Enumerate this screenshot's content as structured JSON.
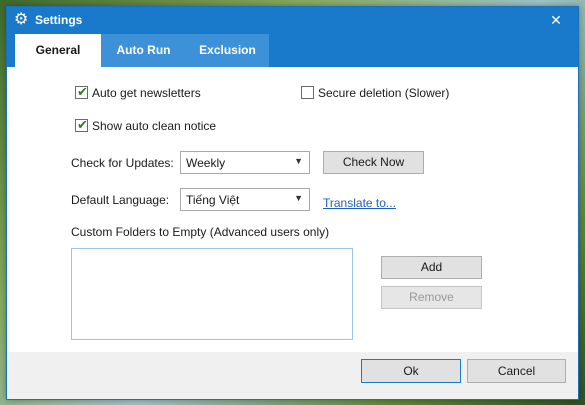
{
  "window": {
    "title": "Settings",
    "title_icon": "gear-icon",
    "close_glyph": "✕"
  },
  "tabs": [
    {
      "label": "General",
      "active": true
    },
    {
      "label": "Auto Run",
      "active": false
    },
    {
      "label": "Exclusion",
      "active": false
    }
  ],
  "general": {
    "auto_newsletters": {
      "label": "Auto get newsletters",
      "checked": true
    },
    "secure_deletion": {
      "label": "Secure deletion (Slower)",
      "checked": false
    },
    "auto_clean_notice": {
      "label": "Show auto clean notice",
      "checked": true
    },
    "updates": {
      "label": "Check for Updates:",
      "value": "Weekly",
      "button": "Check Now"
    },
    "language": {
      "label": "Default Language:",
      "value": "Tiếng Việt",
      "link": "Translate to..."
    },
    "custom_folders": {
      "label": "Custom Folders to Empty (Advanced users only)",
      "items": []
    },
    "add_button": "Add",
    "remove_button": "Remove"
  },
  "footer": {
    "ok_label": "Ok",
    "cancel_label": "Cancel"
  },
  "colors": {
    "titlebar": "#1979ca",
    "tab_inactive": "#3d91d8",
    "check": "#2d7d1f",
    "link": "#1f5fbf"
  }
}
